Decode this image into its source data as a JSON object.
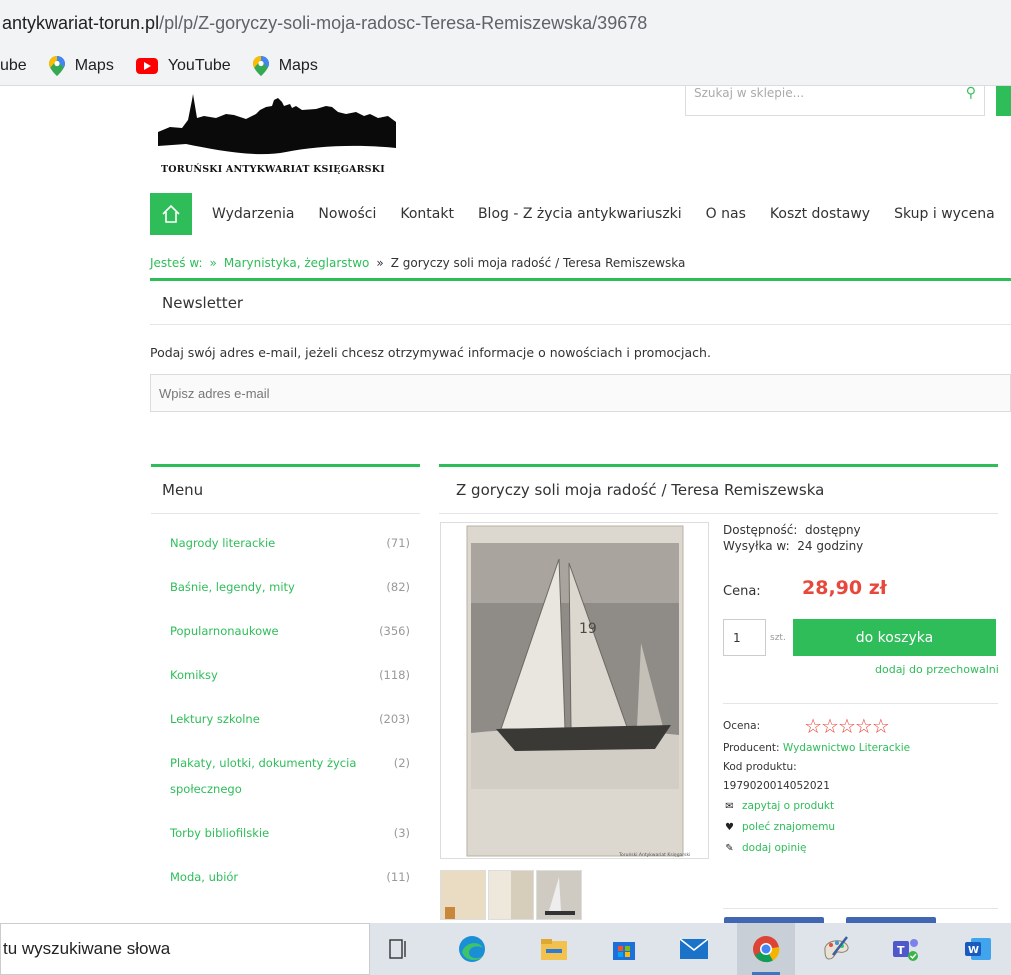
{
  "browser": {
    "url_domain": "antykwariat-torun.pl",
    "url_path": "/pl/p/Z-goryczy-soli-moja-radosc-Teresa-Remiszewska/39678",
    "bookmarks": [
      {
        "label": "ube",
        "icon": "youtube-icon"
      },
      {
        "label": "Maps",
        "icon": "maps-pin-icon"
      },
      {
        "label": "YouTube",
        "icon": "youtube-icon"
      },
      {
        "label": "Maps",
        "icon": "maps-pin-icon"
      }
    ]
  },
  "header": {
    "logo_text": "TORUŃSKI ANTYKWARIAT KSIĘGARSKI",
    "search_placeholder": "Szukaj w sklepie..."
  },
  "nav": {
    "items": [
      "Wydarzenia",
      "Nowości",
      "Kontakt",
      "Blog - Z życia antykwariuszki",
      "O nas",
      "Koszt dostawy",
      "Skup i wycena"
    ]
  },
  "breadcrumb": {
    "prefix": "Jesteś w:",
    "sep": "»",
    "category": "Marynistyka, żeglarstwo",
    "current": "Z goryczy soli moja radość / Teresa Remiszewska"
  },
  "newsletter": {
    "title": "Newsletter",
    "description": "Podaj swój adres e-mail, jeżeli chcesz otrzymywać informacje o nowościach i promocjach.",
    "placeholder": "Wpisz adres e-mail"
  },
  "menu": {
    "title": "Menu",
    "items": [
      {
        "label": "Nagrody literackie",
        "count": "(71)"
      },
      {
        "label": "Baśnie, legendy, mity",
        "count": "(82)"
      },
      {
        "label": "Popularnonaukowe",
        "count": "(356)"
      },
      {
        "label": "Komiksy",
        "count": "(118)"
      },
      {
        "label": "Lektury szkolne",
        "count": "(203)"
      },
      {
        "label": "Plakaty, ulotki, dokumenty życia społecznego",
        "count": "(2)"
      },
      {
        "label": "Torby bibliofilskie",
        "count": "(3)"
      },
      {
        "label": "Moda, ubiór",
        "count": "(11)"
      }
    ]
  },
  "product": {
    "title": "Z goryczy soli moja radość / Teresa Remiszewska",
    "availability_label": "Dostępność:",
    "availability_value": "dostępny",
    "shipping_label": "Wysyłka w:",
    "shipping_value": "24 godziny",
    "price_label": "Cena:",
    "price": "28,90 zł",
    "qty": "1",
    "qty_unit": "szt.",
    "cart_label": "do koszyka",
    "store_link": "dodaj do przechowalni",
    "rating_label": "Ocena:",
    "producer_label": "Producent:",
    "producer_value": "Wydawnictwo Literackie",
    "code_label": "Kod produktu:",
    "code_value": "1979020014052021",
    "actions": [
      "zapytaj o produkt",
      "poleć znajomemu",
      "dodaj opinię"
    ],
    "image_caption": "Toruński Antykwariat Księgarski",
    "sail_number": "19"
  },
  "taskbar": {
    "search_text": "tu wyszukiwane słowa"
  },
  "colors": {
    "accent": "#2ebd59",
    "price": "#e8473b"
  }
}
